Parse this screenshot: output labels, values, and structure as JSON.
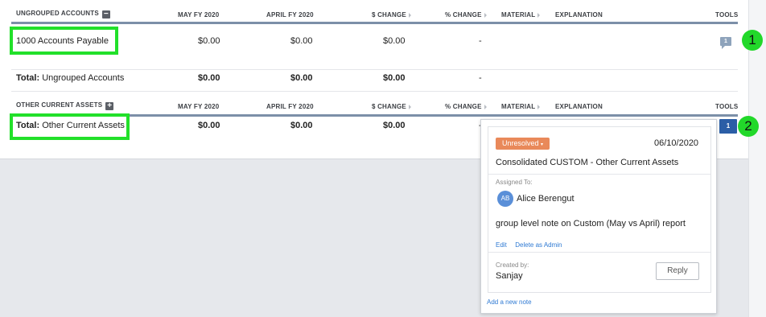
{
  "columns": {
    "may": "MAY FY 2020",
    "april": "APRIL FY 2020",
    "change": "$ CHANGE",
    "pct": "% CHANGE",
    "material": "MATERIAL",
    "explanation": "EXPLANATION",
    "tools": "TOOLS"
  },
  "groups": [
    {
      "name": "UNGROUPED ACCOUNTS",
      "toggle": "−",
      "rows": [
        {
          "label": "1000 Accounts Payable",
          "may": "$0.00",
          "april": "$0.00",
          "change": "$0.00",
          "pct": "-",
          "note_count": "1"
        }
      ],
      "total": {
        "prefix": "Total:",
        "label": "Ungrouped Accounts",
        "may": "$0.00",
        "april": "$0.00",
        "change": "$0.00",
        "pct": "-"
      }
    },
    {
      "name": "OTHER CURRENT ASSETS",
      "toggle": "+",
      "total": {
        "prefix": "Total:",
        "label": "Other Current Assets",
        "may": "$0.00",
        "april": "$0.00",
        "change": "$0.00",
        "pct": "-",
        "note_count": "1"
      }
    }
  ],
  "callouts": [
    "1",
    "2"
  ],
  "note_popup": {
    "status": "Unresolved",
    "date": "06/10/2020",
    "title": "Consolidated CUSTOM - Other Current Assets",
    "assigned_label": "Assigned To:",
    "assignee_initials": "AB",
    "assignee": "Alice Berengut",
    "body": "group level note on Custom (May vs April) report",
    "edit": "Edit",
    "delete": "Delete as Admin",
    "created_label": "Created by:",
    "creator": "Sanjay",
    "reply": "Reply",
    "add_note": "Add a new note"
  },
  "colors": {
    "highlight": "#22e02a",
    "status": "#e9895a",
    "link": "#2f7ad3",
    "rule": "#7c8fa8"
  }
}
